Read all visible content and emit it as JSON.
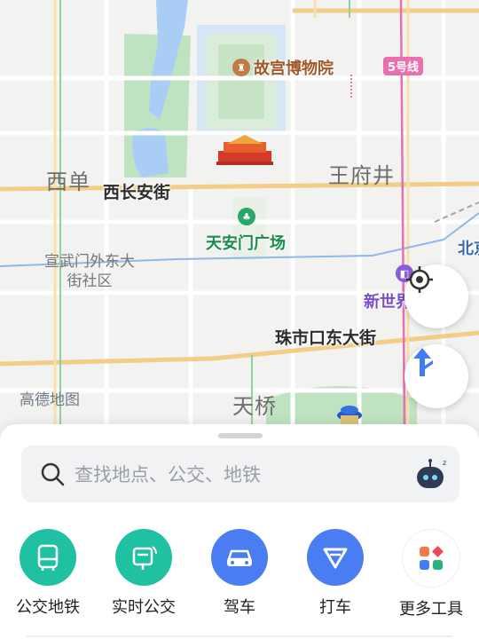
{
  "map": {
    "districts": {
      "xidan": "西单",
      "wangfujing": "王府井",
      "tianqiao": "天桥"
    },
    "roads": {
      "xichanganjie": "西长安街",
      "zhushikou": "珠市口东大街"
    },
    "pois": {
      "palace_museum": "故宫博物院",
      "tiananmen_square": "天安门广场",
      "new_world": "新世界",
      "beijing_partial": "北京"
    },
    "community": "宣武门外东大街社区",
    "metro_line": "5号线",
    "watermark": "高德地图",
    "colors": {
      "water": "#a9cdf5",
      "park": "#bfe3c0",
      "arterial": "#f1cd86",
      "metro": "#ea6fb0",
      "accent": "#3f7cf5"
    }
  },
  "controls": {
    "locate_icon": "locate-icon",
    "navigate_icon": "navigation-arrow-icon"
  },
  "search": {
    "placeholder": "查找地点、公交、地铁"
  },
  "tools": [
    {
      "label": "公交地铁",
      "icon": "bus-icon",
      "color": "#1fc1a2"
    },
    {
      "label": "实时公交",
      "icon": "realtime-bus-icon",
      "color": "#1fc1a2"
    },
    {
      "label": "驾车",
      "icon": "car-icon",
      "color": "#4a7df1"
    },
    {
      "label": "打车",
      "icon": "taxi-icon",
      "color": "#4a7df1"
    },
    {
      "label": "更多工具",
      "icon": "more-tools-icon",
      "color": "#ffffff"
    }
  ]
}
